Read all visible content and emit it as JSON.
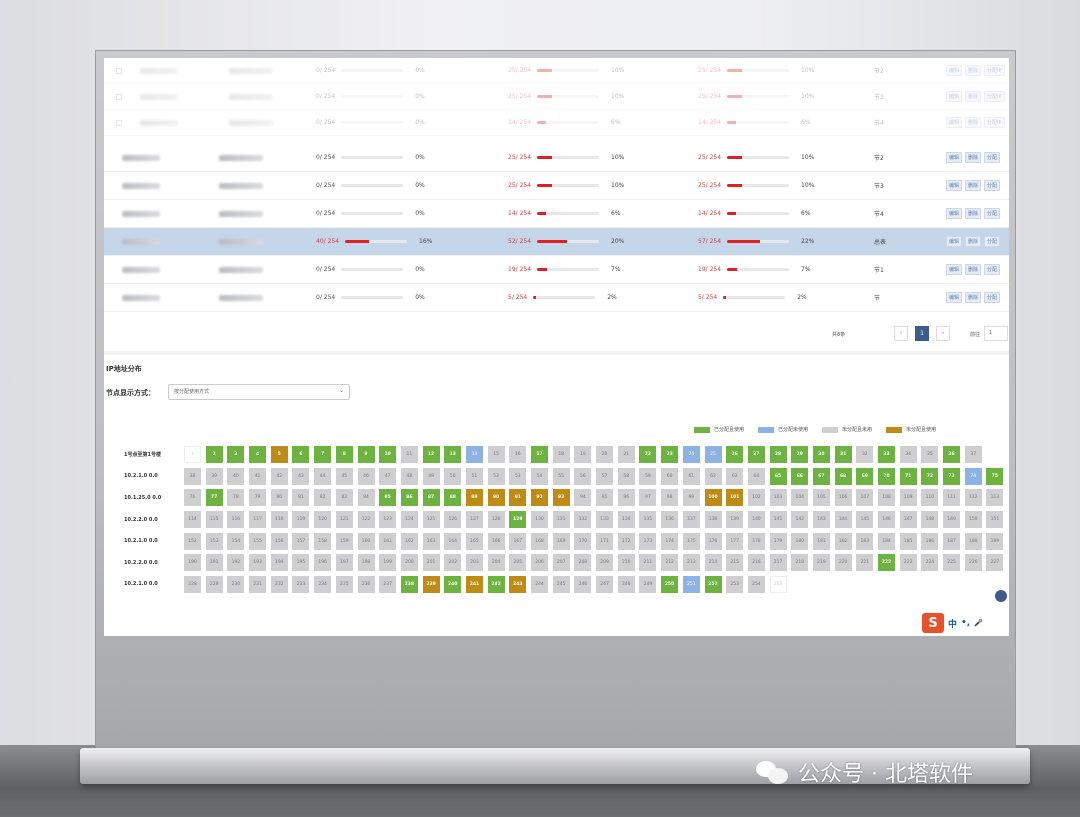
{
  "rows": [
    {
      "faded": true,
      "s1": "0/ 254",
      "p1": 0,
      "t1": "0%",
      "s2": "25/ 254",
      "p2": 10,
      "t2": "10%",
      "s3": "25/ 254",
      "p3": 10,
      "t3": "10%",
      "node": "节2",
      "ops": [
        "编辑",
        "删除",
        "分配IP"
      ]
    },
    {
      "faded": true,
      "s1": "0/ 254",
      "p1": 0,
      "t1": "0%",
      "s2": "25/ 254",
      "p2": 10,
      "t2": "10%",
      "s3": "25/ 254",
      "p3": 10,
      "t3": "10%",
      "node": "节3",
      "ops": [
        "编辑",
        "删除",
        "分配IP"
      ]
    },
    {
      "faded": true,
      "s1": "0/ 254",
      "p1": 0,
      "t1": "0%",
      "s2": "14/ 254",
      "p2": 6,
      "t2": "6%",
      "s3": "14/ 254",
      "p3": 6,
      "t3": "6%",
      "node": "节4",
      "ops": [
        "编辑",
        "删除",
        "分配IP"
      ]
    },
    {
      "s1": "0/ 254",
      "p1": 0,
      "t1": "0%",
      "s2": "25/ 254",
      "p2": 10,
      "t2": "10%",
      "s3": "25/ 254",
      "p3": 10,
      "t3": "10%",
      "node": "节2",
      "ops": [
        "编辑",
        "删除",
        "分配"
      ]
    },
    {
      "s1": "0/ 254",
      "p1": 0,
      "t1": "0%",
      "s2": "25/ 254",
      "p2": 10,
      "t2": "10%",
      "s3": "25/ 254",
      "p3": 10,
      "t3": "10%",
      "node": "节3",
      "ops": [
        "编辑",
        "删除",
        "分配"
      ]
    },
    {
      "s1": "0/ 254",
      "p1": 0,
      "t1": "0%",
      "s2": "14/ 254",
      "p2": 6,
      "t2": "6%",
      "s3": "14/ 254",
      "p3": 6,
      "t3": "6%",
      "node": "节4",
      "ops": [
        "编辑",
        "删除",
        "分配"
      ]
    },
    {
      "selected": true,
      "s1": "40/ 254",
      "p1": 16,
      "t1": "16%",
      "s2": "52/ 254",
      "p2": 20,
      "t2": "20%",
      "s3": "57/ 254",
      "p3": 22,
      "t3": "22%",
      "node": "总表",
      "ops": [
        "编辑",
        "删除",
        "分配"
      ]
    },
    {
      "s1": "0/ 254",
      "p1": 0,
      "t1": "0%",
      "s2": "19/ 254",
      "p2": 7,
      "t2": "7%",
      "s3": "19/ 254",
      "p3": 7,
      "t3": "7%",
      "node": "节1",
      "ops": [
        "编辑",
        "删除",
        "分配"
      ]
    },
    {
      "s1": "0/ 254",
      "p1": 0,
      "t1": "0%",
      "s2": "5/ 254",
      "p2": 2,
      "t2": "2%",
      "s3": "5/ 254",
      "p3": 2,
      "t3": "2%",
      "node": "节",
      "ops": [
        "编辑",
        "删除",
        "分配"
      ]
    }
  ],
  "pager": {
    "total": "共8条",
    "prev": "‹",
    "page": "1",
    "next": "›",
    "goto": "前往",
    "goto_value": "1"
  },
  "section": {
    "title": "IP地址分布",
    "mode_label": "节点显示方式：",
    "mode_value": "按分配使用方式"
  },
  "legend": [
    {
      "label": "已分配且使用",
      "color": "#6db33f"
    },
    {
      "label": "已分配未使用",
      "color": "#8db3e4"
    },
    {
      "label": "未分配且未用",
      "color": "#cfcfd1"
    },
    {
      "label": "未分配且使用",
      "color": "#c08b14"
    }
  ],
  "grid": [
    {
      "label": "1号点至第1号楼",
      "cells": [
        [
          "1",
          "s4"
        ],
        [
          "2",
          "s1"
        ],
        [
          "3",
          "s1"
        ],
        [
          "4",
          "s1"
        ],
        [
          "5",
          "s3"
        ],
        [
          "6",
          "s1"
        ],
        [
          "7",
          "s1"
        ],
        [
          "8",
          "s1"
        ],
        [
          "9",
          "s1"
        ],
        [
          "10",
          "s1"
        ],
        [
          "11",
          ""
        ],
        [
          "12",
          "s1"
        ],
        [
          "13",
          "s1"
        ],
        [
          "14",
          "s2"
        ],
        [
          "15",
          ""
        ],
        [
          "16",
          ""
        ],
        [
          "17",
          "s1"
        ],
        [
          "18",
          ""
        ],
        [
          "19",
          ""
        ],
        [
          "20",
          ""
        ],
        [
          "21",
          ""
        ],
        [
          "22",
          "s1"
        ],
        [
          "23",
          "s1"
        ],
        [
          "24",
          "s2"
        ],
        [
          "25",
          "s2"
        ],
        [
          "26",
          "s1"
        ],
        [
          "27",
          "s1"
        ],
        [
          "28",
          "s1"
        ],
        [
          "29",
          "s1"
        ],
        [
          "30",
          "s1"
        ],
        [
          "31",
          "s1"
        ],
        [
          "32",
          ""
        ],
        [
          "33",
          "s1"
        ],
        [
          "34",
          ""
        ],
        [
          "35",
          ""
        ],
        [
          "36",
          "s1"
        ],
        [
          "37",
          ""
        ]
      ]
    },
    {
      "label": "10.2.1.0 0.0",
      "cells": [
        [
          "38",
          ""
        ],
        [
          "39",
          ""
        ],
        [
          "40",
          ""
        ],
        [
          "41",
          ""
        ],
        [
          "42",
          ""
        ],
        [
          "43",
          ""
        ],
        [
          "44",
          ""
        ],
        [
          "45",
          ""
        ],
        [
          "46",
          ""
        ],
        [
          "47",
          ""
        ],
        [
          "48",
          ""
        ],
        [
          "49",
          ""
        ],
        [
          "50",
          ""
        ],
        [
          "51",
          ""
        ],
        [
          "52",
          ""
        ],
        [
          "53",
          ""
        ],
        [
          "54",
          ""
        ],
        [
          "55",
          ""
        ],
        [
          "56",
          ""
        ],
        [
          "57",
          ""
        ],
        [
          "58",
          ""
        ],
        [
          "59",
          ""
        ],
        [
          "60",
          ""
        ],
        [
          "61",
          ""
        ],
        [
          "62",
          ""
        ],
        [
          "63",
          ""
        ],
        [
          "64",
          ""
        ],
        [
          "65",
          "s1"
        ],
        [
          "66",
          "s1"
        ],
        [
          "67",
          "s1"
        ],
        [
          "68",
          "s1"
        ],
        [
          "69",
          "s1"
        ],
        [
          "70",
          "s1"
        ],
        [
          "71",
          "s1"
        ],
        [
          "72",
          "s1"
        ],
        [
          "73",
          "s1"
        ],
        [
          "74",
          "s2"
        ],
        [
          "75",
          "s1"
        ]
      ]
    },
    {
      "label": "10.1.25.0 0.0",
      "cells": [
        [
          "76",
          ""
        ],
        [
          "77",
          "s1"
        ],
        [
          "78",
          ""
        ],
        [
          "79",
          ""
        ],
        [
          "80",
          ""
        ],
        [
          "81",
          ""
        ],
        [
          "82",
          ""
        ],
        [
          "83",
          ""
        ],
        [
          "84",
          ""
        ],
        [
          "85",
          "s1"
        ],
        [
          "86",
          "s1"
        ],
        [
          "87",
          "s1"
        ],
        [
          "88",
          "s1"
        ],
        [
          "89",
          "s3"
        ],
        [
          "90",
          "s3"
        ],
        [
          "91",
          "s3"
        ],
        [
          "92",
          "s3"
        ],
        [
          "93",
          "s3"
        ],
        [
          "94",
          ""
        ],
        [
          "95",
          ""
        ],
        [
          "96",
          ""
        ],
        [
          "97",
          ""
        ],
        [
          "98",
          ""
        ],
        [
          "99",
          ""
        ],
        [
          "100",
          "s3"
        ],
        [
          "101",
          "s3"
        ],
        [
          "102",
          ""
        ],
        [
          "103",
          ""
        ],
        [
          "104",
          ""
        ],
        [
          "105",
          ""
        ],
        [
          "106",
          ""
        ],
        [
          "107",
          ""
        ],
        [
          "108",
          ""
        ],
        [
          "109",
          ""
        ],
        [
          "110",
          ""
        ],
        [
          "111",
          ""
        ],
        [
          "112",
          ""
        ],
        [
          "113",
          ""
        ]
      ]
    },
    {
      "label": "10.2.2.0 0.0",
      "cells": [
        [
          "114",
          ""
        ],
        [
          "115",
          ""
        ],
        [
          "116",
          ""
        ],
        [
          "117",
          ""
        ],
        [
          "118",
          ""
        ],
        [
          "119",
          ""
        ],
        [
          "120",
          ""
        ],
        [
          "121",
          ""
        ],
        [
          "122",
          ""
        ],
        [
          "123",
          ""
        ],
        [
          "124",
          ""
        ],
        [
          "125",
          ""
        ],
        [
          "126",
          ""
        ],
        [
          "127",
          ""
        ],
        [
          "128",
          ""
        ],
        [
          "129",
          "s1"
        ],
        [
          "130",
          ""
        ],
        [
          "131",
          ""
        ],
        [
          "132",
          ""
        ],
        [
          "133",
          ""
        ],
        [
          "134",
          ""
        ],
        [
          "135",
          ""
        ],
        [
          "136",
          ""
        ],
        [
          "137",
          ""
        ],
        [
          "138",
          ""
        ],
        [
          "139",
          ""
        ],
        [
          "140",
          ""
        ],
        [
          "141",
          ""
        ],
        [
          "142",
          ""
        ],
        [
          "143",
          ""
        ],
        [
          "144",
          ""
        ],
        [
          "145",
          ""
        ],
        [
          "146",
          ""
        ],
        [
          "147",
          ""
        ],
        [
          "148",
          ""
        ],
        [
          "149",
          ""
        ],
        [
          "150",
          ""
        ],
        [
          "151",
          ""
        ]
      ]
    },
    {
      "label": "10.2.1.0 0.0",
      "cells": [
        [
          "152",
          ""
        ],
        [
          "153",
          ""
        ],
        [
          "154",
          ""
        ],
        [
          "155",
          ""
        ],
        [
          "156",
          ""
        ],
        [
          "157",
          ""
        ],
        [
          "158",
          ""
        ],
        [
          "159",
          ""
        ],
        [
          "160",
          ""
        ],
        [
          "161",
          ""
        ],
        [
          "162",
          ""
        ],
        [
          "163",
          ""
        ],
        [
          "164",
          ""
        ],
        [
          "165",
          ""
        ],
        [
          "166",
          ""
        ],
        [
          "167",
          ""
        ],
        [
          "168",
          ""
        ],
        [
          "169",
          ""
        ],
        [
          "170",
          ""
        ],
        [
          "171",
          ""
        ],
        [
          "172",
          ""
        ],
        [
          "173",
          ""
        ],
        [
          "174",
          ""
        ],
        [
          "175",
          ""
        ],
        [
          "176",
          ""
        ],
        [
          "177",
          ""
        ],
        [
          "178",
          ""
        ],
        [
          "179",
          ""
        ],
        [
          "180",
          ""
        ],
        [
          "181",
          ""
        ],
        [
          "182",
          ""
        ],
        [
          "183",
          ""
        ],
        [
          "184",
          ""
        ],
        [
          "185",
          ""
        ],
        [
          "186",
          ""
        ],
        [
          "187",
          ""
        ],
        [
          "188",
          ""
        ],
        [
          "189",
          ""
        ]
      ]
    },
    {
      "label": "10.2.2.0 0.0",
      "cells": [
        [
          "190",
          ""
        ],
        [
          "191",
          ""
        ],
        [
          "192",
          ""
        ],
        [
          "193",
          ""
        ],
        [
          "194",
          ""
        ],
        [
          "195",
          ""
        ],
        [
          "196",
          ""
        ],
        [
          "197",
          ""
        ],
        [
          "198",
          ""
        ],
        [
          "199",
          ""
        ],
        [
          "200",
          ""
        ],
        [
          "201",
          ""
        ],
        [
          "202",
          ""
        ],
        [
          "203",
          ""
        ],
        [
          "204",
          ""
        ],
        [
          "205",
          ""
        ],
        [
          "206",
          ""
        ],
        [
          "207",
          ""
        ],
        [
          "208",
          ""
        ],
        [
          "209",
          ""
        ],
        [
          "210",
          ""
        ],
        [
          "211",
          ""
        ],
        [
          "212",
          ""
        ],
        [
          "213",
          ""
        ],
        [
          "214",
          ""
        ],
        [
          "215",
          ""
        ],
        [
          "216",
          ""
        ],
        [
          "217",
          ""
        ],
        [
          "218",
          ""
        ],
        [
          "219",
          ""
        ],
        [
          "220",
          ""
        ],
        [
          "221",
          ""
        ],
        [
          "222",
          "s1"
        ],
        [
          "223",
          ""
        ],
        [
          "224",
          ""
        ],
        [
          "225",
          ""
        ],
        [
          "226",
          ""
        ],
        [
          "227",
          ""
        ]
      ]
    },
    {
      "label": "10.2.1.0 0.0",
      "cells": [
        [
          "228",
          ""
        ],
        [
          "229",
          ""
        ],
        [
          "230",
          ""
        ],
        [
          "231",
          ""
        ],
        [
          "232",
          ""
        ],
        [
          "233",
          ""
        ],
        [
          "234",
          ""
        ],
        [
          "235",
          ""
        ],
        [
          "236",
          ""
        ],
        [
          "237",
          ""
        ],
        [
          "238",
          "s1"
        ],
        [
          "239",
          "s3"
        ],
        [
          "240",
          "s1"
        ],
        [
          "241",
          "s3"
        ],
        [
          "242",
          "s1"
        ],
        [
          "243",
          "s3"
        ],
        [
          "244",
          ""
        ],
        [
          "245",
          ""
        ],
        [
          "246",
          ""
        ],
        [
          "247",
          ""
        ],
        [
          "248",
          ""
        ],
        [
          "249",
          ""
        ],
        [
          "250",
          "s1"
        ],
        [
          "251",
          "s2"
        ],
        [
          "252",
          "s1"
        ],
        [
          "253",
          ""
        ],
        [
          "254",
          ""
        ],
        [
          "255",
          "s4"
        ]
      ]
    }
  ],
  "ime": {
    "logo": "S",
    "lang": "中",
    "punct": "•,",
    "mic": "🎤"
  },
  "watermark": {
    "text": "公众号 · 北塔软件"
  }
}
